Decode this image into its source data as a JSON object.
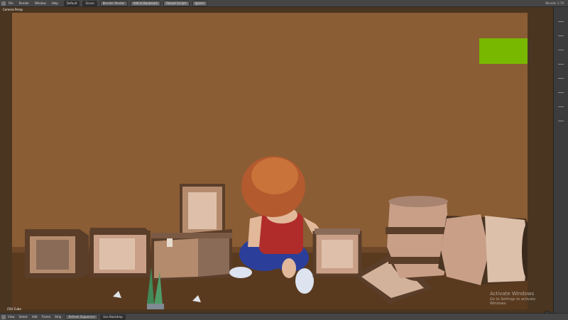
{
  "topbar": {
    "menus": [
      "File",
      "Render",
      "Window",
      "Help"
    ],
    "layout": "Default",
    "scene": "Scene",
    "engine": "Blender Render",
    "buttons": [
      "Add to Bookmark",
      "Reload Scripts",
      "Ignore"
    ],
    "version_info": "Blender 2.79"
  },
  "viewport": {
    "view_label": "Camera Persp",
    "object_label": "(50) Cube",
    "watermark_title": "Activate Windows",
    "watermark_sub": "Go to Settings to activate Windows."
  },
  "bottombar": {
    "menus": [
      "View",
      "Select",
      "Add",
      "Frame",
      "Strip"
    ],
    "selector1": "Refresh Sequencer",
    "selector2": "Use Backdrop"
  },
  "colors": {
    "wall": "#8b5d35",
    "floor": "#5a3a1f",
    "green_screen": "#78b800",
    "box_wood": "#b58b6e",
    "shirt": "#b02c2a",
    "jeans": "#2b3f9a"
  },
  "icons": [
    "editor-type-icon",
    "axis-gizmo-icon",
    "navigation-gizmo-icon"
  ]
}
